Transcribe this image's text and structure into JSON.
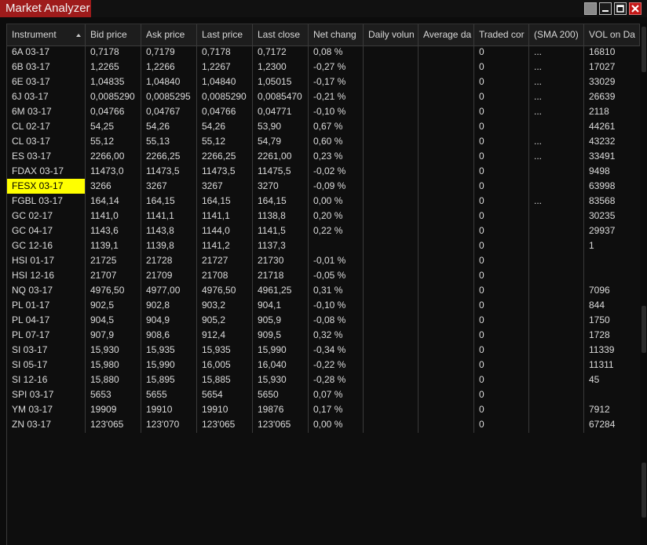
{
  "window": {
    "title": "Market Analyzer",
    "controls": [
      "options-icon",
      "minimize-icon",
      "maximize-icon",
      "close-icon"
    ]
  },
  "columns": [
    "Instrument",
    "Bid price",
    "Ask price",
    "Last price",
    "Last close",
    "Net chang",
    "Daily volun",
    "Average da",
    "Traded cor",
    "(SMA 200)",
    "VOL on Da"
  ],
  "sorted_column": "Instrument",
  "selected_row": "FESX 03-17",
  "colors": {
    "title_bar": "#9e1b1b",
    "highlight": "#ffff00",
    "background": "#0c0c0c"
  },
  "rows": [
    [
      "6A 03-17",
      "0,7178",
      "0,7179",
      "0,7178",
      "0,7172",
      "0,08 %",
      "",
      "",
      "0",
      "...",
      "16810"
    ],
    [
      "6B 03-17",
      "1,2265",
      "1,2266",
      "1,2267",
      "1,2300",
      "-0,27 %",
      "",
      "",
      "0",
      "...",
      "17027"
    ],
    [
      "6E 03-17",
      "1,04835",
      "1,04840",
      "1,04840",
      "1,05015",
      "-0,17 %",
      "",
      "",
      "0",
      "...",
      "33029"
    ],
    [
      "6J 03-17",
      "0,0085290",
      "0,0085295",
      "0,0085290",
      "0,0085470",
      "-0,21 %",
      "",
      "",
      "0",
      "...",
      "26639"
    ],
    [
      "6M 03-17",
      "0,04766",
      "0,04767",
      "0,04766",
      "0,04771",
      "-0,10 %",
      "",
      "",
      "0",
      "...",
      "2118"
    ],
    [
      "CL 02-17",
      "54,25",
      "54,26",
      "54,26",
      "53,90",
      "0,67 %",
      "",
      "",
      "0",
      "",
      "44261"
    ],
    [
      "CL 03-17",
      "55,12",
      "55,13",
      "55,12",
      "54,79",
      "0,60 %",
      "",
      "",
      "0",
      "...",
      "43232"
    ],
    [
      "ES 03-17",
      "2266,00",
      "2266,25",
      "2266,25",
      "2261,00",
      "0,23 %",
      "",
      "",
      "0",
      "...",
      "33491"
    ],
    [
      "FDAX 03-17",
      "11473,0",
      "11473,5",
      "11473,5",
      "11475,5",
      "-0,02 %",
      "",
      "",
      "0",
      "",
      "9498"
    ],
    [
      "FESX 03-17",
      "3266",
      "3267",
      "3267",
      "3270",
      "-0,09 %",
      "",
      "",
      "0",
      "",
      "63998"
    ],
    [
      "FGBL 03-17",
      "164,14",
      "164,15",
      "164,15",
      "164,15",
      "0,00 %",
      "",
      "",
      "0",
      "...",
      "83568"
    ],
    [
      "GC 02-17",
      "1141,0",
      "1141,1",
      "1141,1",
      "1138,8",
      "0,20 %",
      "",
      "",
      "0",
      "",
      "30235"
    ],
    [
      "GC 04-17",
      "1143,6",
      "1143,8",
      "1144,0",
      "1141,5",
      "0,22 %",
      "",
      "",
      "0",
      "",
      "29937"
    ],
    [
      "GC 12-16",
      "1139,1",
      "1139,8",
      "1141,2",
      "1137,3",
      "",
      "",
      "",
      "0",
      "",
      "1"
    ],
    [
      "HSI 01-17",
      "21725",
      "21728",
      "21727",
      "21730",
      "-0,01 %",
      "",
      "",
      "0",
      "",
      ""
    ],
    [
      "HSI 12-16",
      "21707",
      "21709",
      "21708",
      "21718",
      "-0,05 %",
      "",
      "",
      "0",
      "",
      ""
    ],
    [
      "NQ 03-17",
      "4976,50",
      "4977,00",
      "4976,50",
      "4961,25",
      "0,31 %",
      "",
      "",
      "0",
      "",
      "7096"
    ],
    [
      "PL 01-17",
      "902,5",
      "902,8",
      "903,2",
      "904,1",
      "-0,10 %",
      "",
      "",
      "0",
      "",
      "844"
    ],
    [
      "PL 04-17",
      "904,5",
      "904,9",
      "905,2",
      "905,9",
      "-0,08 %",
      "",
      "",
      "0",
      "",
      "1750"
    ],
    [
      "PL 07-17",
      "907,9",
      "908,6",
      "912,4",
      "909,5",
      "0,32 %",
      "",
      "",
      "0",
      "",
      "1728"
    ],
    [
      "SI 03-17",
      "15,930",
      "15,935",
      "15,935",
      "15,990",
      "-0,34 %",
      "",
      "",
      "0",
      "",
      "11339"
    ],
    [
      "SI 05-17",
      "15,980",
      "15,990",
      "16,005",
      "16,040",
      "-0,22 %",
      "",
      "",
      "0",
      "",
      "11311"
    ],
    [
      "SI 12-16",
      "15,880",
      "15,895",
      "15,885",
      "15,930",
      "-0,28 %",
      "",
      "",
      "0",
      "",
      "45"
    ],
    [
      "SPI 03-17",
      "5653",
      "5655",
      "5654",
      "5650",
      "0,07 %",
      "",
      "",
      "0",
      "",
      ""
    ],
    [
      "YM 03-17",
      "19909",
      "19910",
      "19910",
      "19876",
      "0,17 %",
      "",
      "",
      "0",
      "",
      "7912"
    ],
    [
      "ZN 03-17",
      "123'065",
      "123'070",
      "123'065",
      "123'065",
      "0,00 %",
      "",
      "",
      "0",
      "",
      "67284"
    ]
  ]
}
